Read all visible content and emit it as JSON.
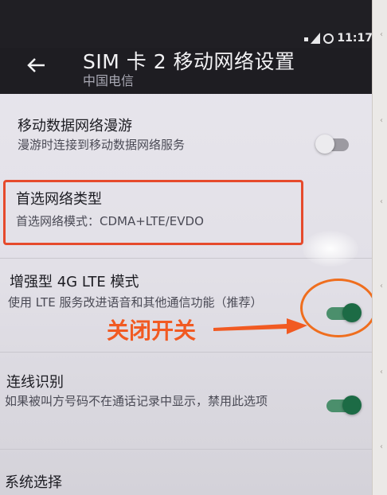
{
  "status_bar": {
    "time": "11:17"
  },
  "app_bar": {
    "title": "SIM 卡 2 移动网络设置",
    "subtitle": "中国电信"
  },
  "settings": [
    {
      "title": "移动数据网络漫游",
      "summary": "漫游时连接到移动数据网络服务",
      "toggle": "off"
    },
    {
      "title": "首选网络类型",
      "summary": "首选网络模式：CDMA+LTE/EVDO"
    },
    {
      "title": "增强型 4G LTE 模式",
      "summary": "使用 LTE 服务改进语音和其他通信功能（推荐）",
      "toggle": "on"
    },
    {
      "title": "连线识别",
      "summary": "如果被叫方号码不在通话记录中显示，禁用此选项",
      "toggle": "on"
    },
    {
      "title": "系统选择"
    }
  ],
  "annotation": {
    "label": "关闭开关",
    "color": "#f15a22"
  },
  "colors": {
    "toggle_on": "#1c6b45",
    "highlight": "#e64a2c"
  }
}
